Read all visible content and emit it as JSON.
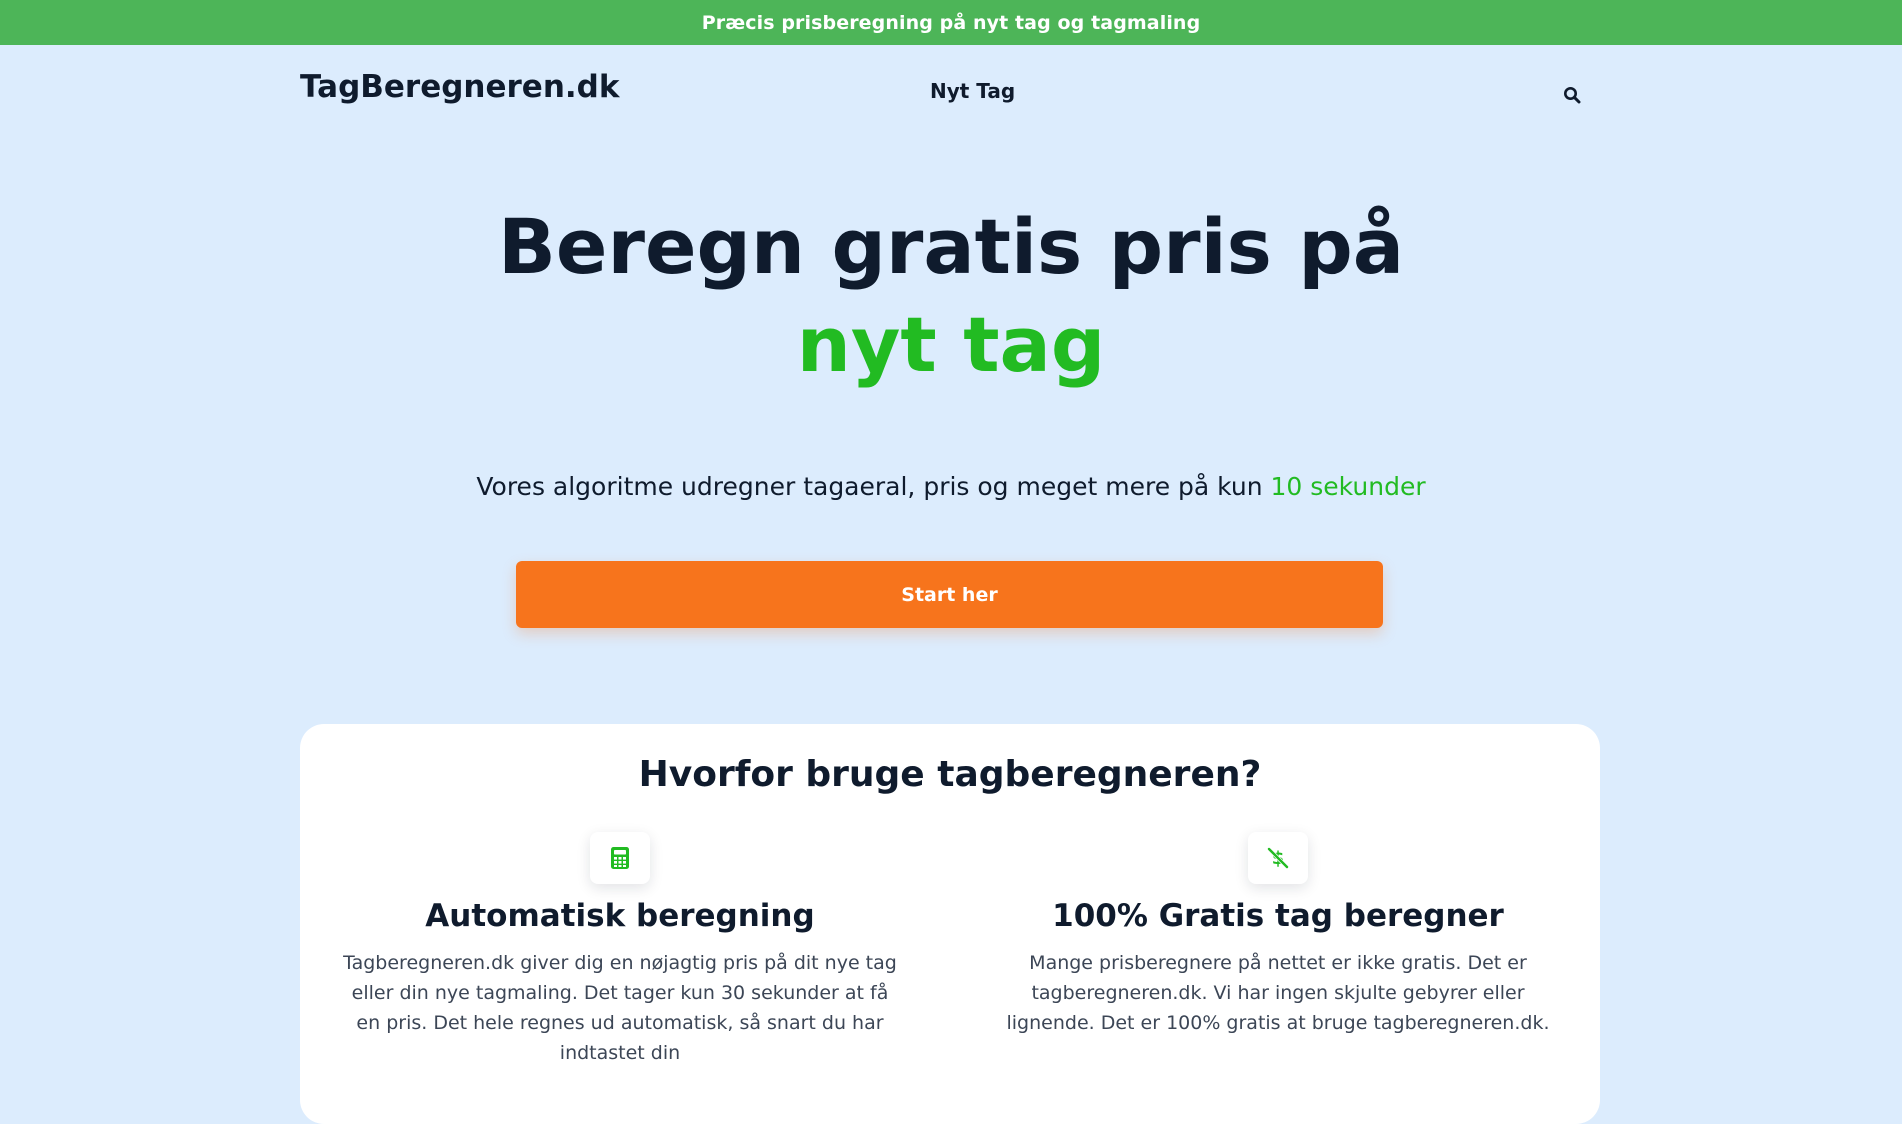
{
  "announcement": "Præcis prisberegning på nyt tag og tagmaling",
  "header": {
    "logo": "TagBeregneren.dk",
    "nav_link": "Nyt Tag",
    "search_icon": "search-icon"
  },
  "hero": {
    "title_line1": "Beregn gratis pris på",
    "title_line2": "nyt tag",
    "subtitle_prefix": "Vores algoritme udregner tagaeral, pris og meget mere på kun ",
    "subtitle_highlight": "10 sekunder",
    "cta_label": "Start her"
  },
  "why": {
    "title": "Hvorfor bruge tagberegneren?",
    "features": [
      {
        "icon": "calculator-icon",
        "title": "Automatisk beregning",
        "text": "Tagberegneren.dk giver dig en nøjagtig pris på dit nye tag eller din nye tagmaling. Det tager kun 30 sekunder at få en pris. Det hele regnes ud automatisk, så snart du har indtastet din"
      },
      {
        "icon": "no-money-icon",
        "title": "100% Gratis tag beregner",
        "text": "Mange prisberegnere på nettet er ikke gratis. Det er tagberegneren.dk. Vi har ingen skjulte gebyrer eller lignende. Det er 100% gratis at bruge tagberegneren.dk."
      }
    ]
  },
  "colors": {
    "announcement_bg": "#4db558",
    "page_bg": "#dcecfd",
    "accent_green": "#22bb22",
    "cta_orange": "#f7741c",
    "text_dark": "#0f1b2d"
  }
}
